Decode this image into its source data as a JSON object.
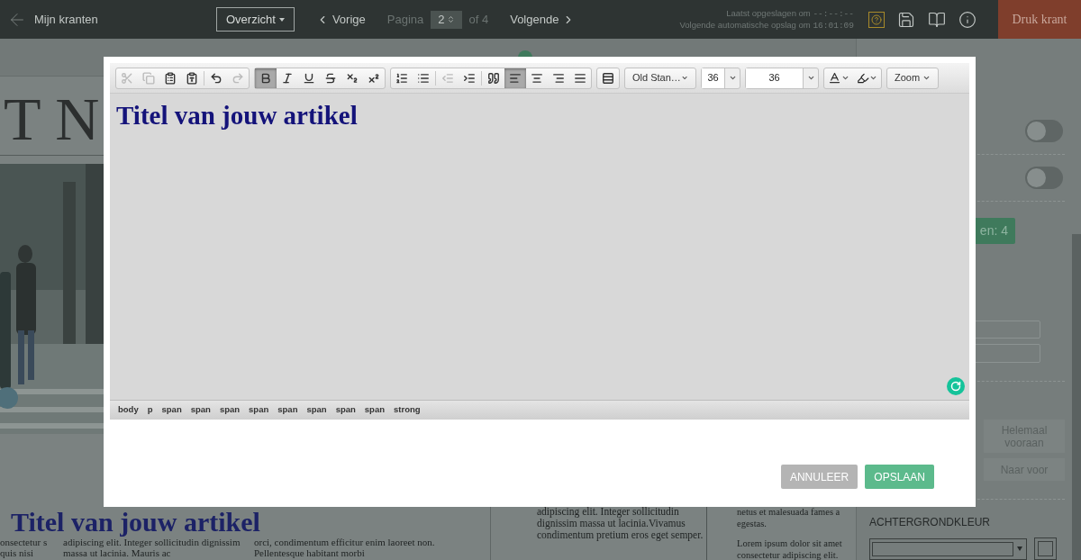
{
  "top_bar": {
    "back_link": "Mijn kranten",
    "view_select": "Overzicht",
    "prev": "Vorige",
    "page_label": "Pagina",
    "page_value": "2",
    "page_total": "of 4",
    "next": "Volgende",
    "last_saved": "Laatst opgeslagen om",
    "last_saved_time": "--:--:--",
    "next_autosave": "Volgende automatische opslag om",
    "next_autosave_time": "16:01:09",
    "print_button": "Druk krant"
  },
  "newspaper": {
    "masthead": "T N",
    "headline": "Titel van jouw artikel",
    "columns": [
      "onsectetur s quis nisi",
      "adipiscing elit. Integer sollicitudin dignissim massa ut lacinia. Mauris ac",
      "orci, condimentum efficitur enim laoreet non. Pellentesque habitant morbi"
    ]
  },
  "second_page": {
    "columns": [
      [
        "adipiscing elit. Integer sollicitudin dignissim massa ut lacinia.Vivamus condimentum pretium eros eget semper."
      ],
      [
        "netus et malesuada fames a egestas.",
        "Lorem ipsum dolor sit amet consectetur adipiscing elit."
      ]
    ]
  },
  "settings_panel": {
    "toggles": [
      {
        "on": false
      },
      {
        "on": false
      }
    ],
    "badge": "en: 4",
    "order_buttons": [
      "Helemaal vooraan",
      "Naar voor"
    ],
    "background_label": "ACHTERGRONDKLEUR"
  },
  "editor": {
    "toolbar": [
      [
        {
          "kind": "cut",
          "selected": false,
          "disabled": true
        },
        {
          "kind": "copy",
          "selected": false,
          "disabled": true
        },
        {
          "kind": "paste",
          "selected": false,
          "disabled": false
        },
        {
          "kind": "paste-word",
          "selected": false,
          "disabled": false
        },
        {
          "kind": "separator"
        },
        {
          "kind": "undo",
          "selected": false,
          "disabled": false
        },
        {
          "kind": "redo",
          "selected": false,
          "disabled": true
        }
      ],
      [
        {
          "kind": "bold",
          "selected": true,
          "disabled": false
        },
        {
          "kind": "italic",
          "selected": false,
          "disabled": false
        },
        {
          "kind": "underline",
          "selected": false,
          "disabled": false
        },
        {
          "kind": "strike",
          "selected": false,
          "disabled": false
        },
        {
          "kind": "subscript",
          "selected": false,
          "disabled": false
        },
        {
          "kind": "superscript",
          "selected": false,
          "disabled": false
        }
      ],
      [
        {
          "kind": "numbered-list",
          "selected": false,
          "disabled": false
        },
        {
          "kind": "bullet-list",
          "selected": false,
          "disabled": false
        },
        {
          "kind": "separator"
        },
        {
          "kind": "outdent",
          "selected": false,
          "disabled": true
        },
        {
          "kind": "indent",
          "selected": false,
          "disabled": false
        },
        {
          "kind": "separator"
        },
        {
          "kind": "blockquote",
          "selected": false,
          "disabled": false
        },
        {
          "kind": "align-left",
          "selected": true,
          "disabled": false
        },
        {
          "kind": "align-center",
          "selected": false,
          "disabled": false
        },
        {
          "kind": "align-right",
          "selected": false,
          "disabled": false
        },
        {
          "kind": "justify",
          "selected": false,
          "disabled": false
        }
      ],
      [
        {
          "kind": "line-height",
          "selected": false,
          "disabled": false
        }
      ]
    ],
    "font": "Old Stan…",
    "font_size": "36",
    "line_size": "36",
    "zoom": "Zoom",
    "title": "Titel van jouw artikel",
    "path": [
      "body",
      "p",
      "span",
      "span",
      "span",
      "span",
      "span",
      "span",
      "span",
      "span",
      "strong"
    ],
    "buttons": [
      {
        "label": "ANNULEER",
        "kind": "cancel"
      },
      {
        "label": "OPSLAAN",
        "kind": "save"
      }
    ]
  }
}
